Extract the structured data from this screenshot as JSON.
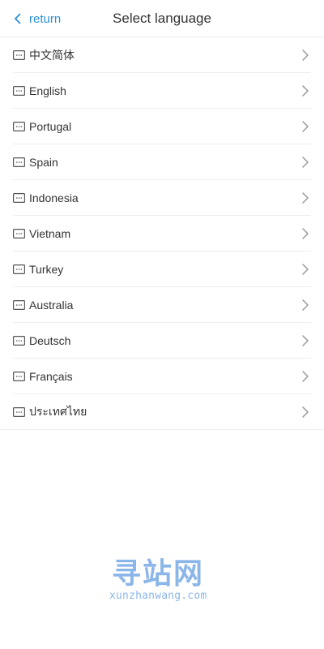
{
  "header": {
    "back_label": "return",
    "title": "Select language"
  },
  "languages": [
    {
      "label": "中文简体"
    },
    {
      "label": "English"
    },
    {
      "label": "Portugal"
    },
    {
      "label": "Spain"
    },
    {
      "label": "Indonesia"
    },
    {
      "label": "Vietnam"
    },
    {
      "label": "Turkey"
    },
    {
      "label": "Australia"
    },
    {
      "label": "Deutsch"
    },
    {
      "label": "Français"
    },
    {
      "label": "ประเทศไทย"
    }
  ],
  "icons": {
    "item_icon": "keyboard-icon",
    "item_arrow": "chevron-right-icon",
    "back": "chevron-left-icon"
  },
  "watermark": {
    "main": "寻站网",
    "sub": "xunzhanwang.com"
  },
  "colors": {
    "accent": "#2a8fd8",
    "text": "#333333",
    "divider": "#eeeeee",
    "watermark": "#2d7bd8"
  }
}
